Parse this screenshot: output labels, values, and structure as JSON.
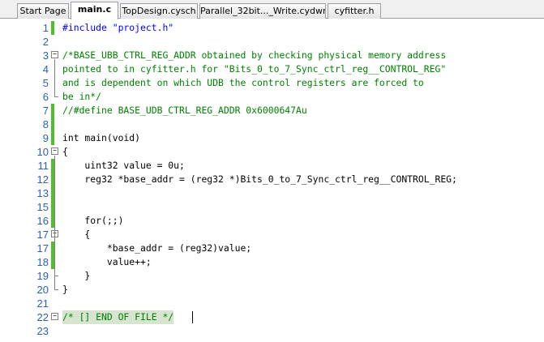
{
  "tabs": [
    {
      "label": "Start Page",
      "active": false
    },
    {
      "label": "main.c",
      "active": true
    },
    {
      "label": "TopDesign.cysch",
      "active": false
    },
    {
      "label": "Parallel_32bit..._Write.cydwr",
      "active": false
    },
    {
      "label": "cyfitter.h",
      "active": false
    }
  ],
  "editor": {
    "lines": [
      {
        "num": "1",
        "text": "#include \"project.h\""
      },
      {
        "num": "2",
        "text": ""
      },
      {
        "num": "3",
        "text": "/*BASE_UBB_CTRL_REG_ADDR obtained by checking physical memory address"
      },
      {
        "num": "4",
        "text": "pointed to in cyfitter.h for \"Bits_0_to_7_Sync_ctrl_reg__CONTROL_REG\""
      },
      {
        "num": "5",
        "text": "and is dependent on which UDB the control registers are forced to"
      },
      {
        "num": "6",
        "text": "be in*/"
      },
      {
        "num": "7",
        "text": "//#define BASE_UDB_CTRL_REG_ADDR 0x6000647Au"
      },
      {
        "num": "8",
        "text": ""
      },
      {
        "num": "9",
        "text": "int main(void)"
      },
      {
        "num": "10",
        "text": "{"
      },
      {
        "num": "11",
        "text": "    uint32 value = 0u;"
      },
      {
        "num": "12",
        "text": "    reg32 *base_addr = (reg32 *)Bits_0_to_7_Sync_ctrl_reg__CONTROL_REG;"
      },
      {
        "num": "13",
        "text": ""
      },
      {
        "num": "15",
        "text": ""
      },
      {
        "num": "16",
        "text": "    for(;;)"
      },
      {
        "num": "17",
        "text": "    {"
      },
      {
        "num": "17",
        "text": "        *base_addr = (reg32)value;"
      },
      {
        "num": "18",
        "text": "        value++;"
      },
      {
        "num": "19",
        "text": "    }"
      },
      {
        "num": "20",
        "text": "}"
      },
      {
        "num": "21",
        "text": ""
      },
      {
        "num": "22",
        "text": "/* [] END OF FILE */"
      },
      {
        "num": "23",
        "text": ""
      }
    ]
  },
  "colors": {
    "keyword": "#0000ff",
    "comment": "#008000",
    "macro": "#800080",
    "line_number": "#2b62b6",
    "modified_marker": "#4fbf2a"
  }
}
